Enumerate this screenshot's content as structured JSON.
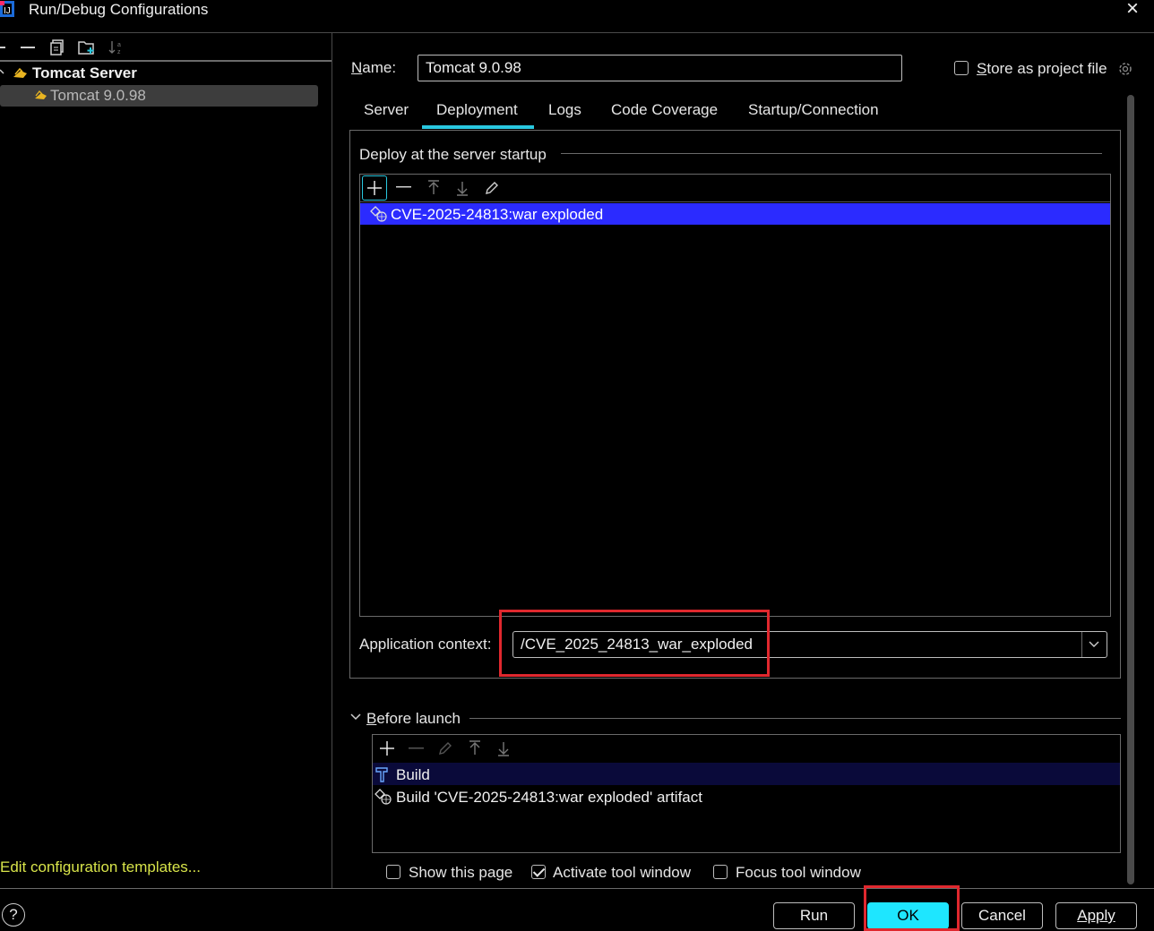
{
  "window": {
    "title": "Run/Debug Configurations",
    "close_label": "×"
  },
  "tree": {
    "group_label": "Tomcat Server",
    "item_label": "Tomcat 9.0.98",
    "edit_templates_link": "Edit configuration templates..."
  },
  "form": {
    "name_label_first": "N",
    "name_label_rest": "ame:",
    "name_value": "Tomcat 9.0.98",
    "store_label_first": "S",
    "store_label_rest": "tore as project file",
    "store_checked": false
  },
  "tabs": [
    {
      "label": "Server",
      "active": false
    },
    {
      "label": "Deployment",
      "active": true
    },
    {
      "label": "Logs",
      "active": false
    },
    {
      "label": "Code Coverage",
      "active": false
    },
    {
      "label": "Startup/Connection",
      "active": false
    }
  ],
  "deploy": {
    "section_title": "Deploy at the server startup",
    "items": [
      {
        "label": "CVE-2025-24813:war exploded",
        "selected": true
      }
    ],
    "app_context_label": "Application context:",
    "app_context_value": "/CVE_2025_24813_war_exploded"
  },
  "before_launch": {
    "title_first": "B",
    "title_rest": "efore launch",
    "tasks": [
      {
        "label": "Build",
        "icon": "hammer-icon"
      },
      {
        "label": "Build 'CVE-2025-24813:war exploded' artifact",
        "icon": "artifact-icon"
      }
    ],
    "options": [
      {
        "label": "Show this page",
        "checked": false
      },
      {
        "label": "Activate tool window",
        "checked": true
      },
      {
        "label": "Focus tool window",
        "checked": false
      }
    ]
  },
  "buttons": {
    "help": "?",
    "run": "Run",
    "ok": "OK",
    "cancel": "Cancel",
    "apply": "Apply"
  },
  "colors": {
    "selection": "#2b2bff",
    "accent": "#29c8e0",
    "ok_button": "#1ee6ff",
    "highlight_box": "#e0282e",
    "link": "#d8e44a"
  }
}
